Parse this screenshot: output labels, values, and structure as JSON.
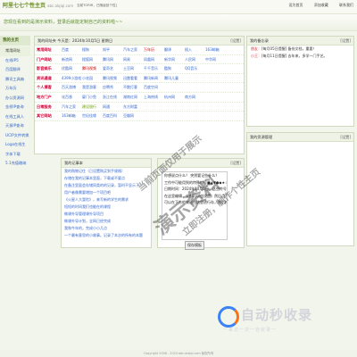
{
  "header": {
    "logo": "阿里七七个性主页",
    "domain": "abc.alqiqi.com",
    "info": "当前TORIR，已随返回个性]",
    "links": [
      "设为首页",
      "添加收藏",
      "联系我们"
    ]
  },
  "hint": "您现在看到的是演示资料，登录后就能定制自己的资料啦~~",
  "sidebar": {
    "title": "我的主页",
    "items": [
      "常用网址",
      "在线IP5",
      "百度翻译",
      "腾讯工具箱",
      "万年历",
      "办公资源网",
      "金桥IP查询",
      "在线工具人",
      "天振IP查询",
      "UCIP文件转换",
      "Logo在线生",
      "字体下载",
      "5.1充值缴纳"
    ]
  },
  "nav": {
    "title": "我的网址夹 今天是：2024年10月5日 星期日",
    "set": "[设置]",
    "rows": [
      {
        "cat": "常用网址",
        "links": [
          "百度",
          "搜狗",
          "知乎",
          "汽车之家",
          "万年历",
          "翻译",
          "插入",
          "163邮箱"
        ]
      },
      {
        "cat": "门户网站",
        "links": [
          "新浪网",
          "搜狐网",
          "腾讯网",
          "网易",
          "凤凰网",
          "新华网",
          "人民网",
          "中华网",
          "环球网",
          "联合早报"
        ]
      },
      {
        "cat": "影音娱乐",
        "links": [
          "优酷网",
          "腾讯视频",
          "爱奇艺",
          "土豆网",
          "千千音乐",
          "酷狗",
          "QQ音乐"
        ]
      },
      {
        "cat": "资讯通道",
        "links": [
          "4399小游戏",
          "小花园",
          "腾讯视频",
          "迅雷看看",
          "腾讯新闻",
          "腾讯儿童"
        ]
      },
      {
        "cat": "个人博客",
        "links": [
          "百天游博",
          "我是游客",
          "应聘秀",
          "不散打客",
          "百度空间"
        ]
      },
      {
        "cat": "地方门户",
        "links": [
          "化百香",
          "厦门小鱼",
          "浙江在线",
          "湖南红网",
          "上海热线",
          "杭州网",
          "南方网"
        ]
      },
      {
        "cat": "日常服务",
        "links": [
          "汽车之家",
          "建设银行",
          "网通",
          "东方财富"
        ]
      },
      {
        "cat": "其它网站",
        "links": [
          "163邮箱",
          "世纪佳缘",
          "百度百科",
          "豆瓣网"
        ]
      }
    ]
  },
  "notebook": {
    "title": "我的记事本",
    "set": "[设置]",
    "items": [
      "我的购物记住（已设置购买到手规格）",
      "存储在我的记事本里面，下载或不要点",
      "在备注里面会存储同类的的记录，暂时不显示了",
      "用户者像需要增加一个项目吧",
      "《火星人大冒险》，来写新的学生的需求",
      "短短的时间我们也能在的课程",
      "做课外导管理课外导项目",
      "做课外导计划，全网已经完成",
      "我和今年的，完成小小几点",
      "一个最有意思的小故事。记录了本次的所有的本题"
    ]
  },
  "memo": {
    "title": "我的备忘录",
    "set": "[设置]",
    "items": [
      {
        "who": "朋友：",
        "text": "[每月05日提醒] 备份文档，重要！"
      },
      {
        "who": "小王：",
        "text": "[每月11日提醒] 去年来，多学一门手艺。"
      }
    ],
    "selector": "全部"
  },
  "info_panel": {
    "title": "我的资源管理",
    "set": "[设置]"
  },
  "editor": {
    "lines": [
      "你想说点什么？ 突然要记些什么？",
      "工作中可能用到的特殊符号■▲▼●◆★☆√×○◎",
      "日期时间：2024年10月5日，这些符号在键盘打不出来，在这里直接复制使用。",
      "在这里编辑，全都可以也设置，然后点“保存模板”即可。",
      "可以在下方的按钮在这里进行存，然后按“保存模板”。"
    ],
    "button": "保存模板"
  },
  "watermark": {
    "big": "演示资料",
    "small1": "当前页面仅用于展示",
    "small2": "立即注册，制作个性主页"
  },
  "brand": {
    "name": "自动秒收录",
    "sub": "一来访一次一自收录一"
  },
  "footer": "Copyright 2008 - 2024 abc.alqiqi.com 版权所有"
}
